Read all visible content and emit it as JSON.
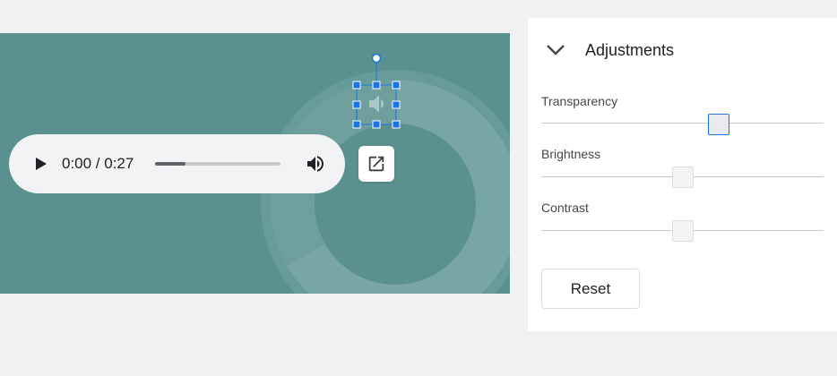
{
  "player": {
    "time_display": "0:00 / 0:27",
    "progress_fraction": 0.24
  },
  "panel": {
    "title": "Adjustments",
    "controls": [
      {
        "label": "Transparency",
        "value_fraction": 0.64
      },
      {
        "label": "Brightness",
        "value_fraction": 0.5
      },
      {
        "label": "Contrast",
        "value_fraction": 0.5
      }
    ],
    "reset_label": "Reset"
  },
  "colors": {
    "slide_bg": "#5a918f",
    "selection": "#1a73e8"
  }
}
